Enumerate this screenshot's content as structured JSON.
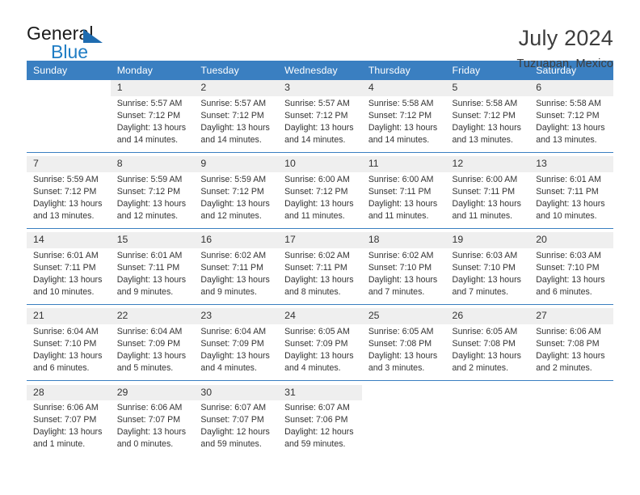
{
  "logo": {
    "word_top": "General",
    "word_bottom": "Blue",
    "triangle_icon": "triangle-icon",
    "color_black": "#1a1a1a",
    "color_blue": "#1f7dc4"
  },
  "header": {
    "title": "July 2024",
    "subtitle": "Tuzuapan, Mexico"
  },
  "theme": {
    "header_blue": "#3a7fc1",
    "daynum_band": "#efefef",
    "text": "#333333"
  },
  "calendar": {
    "weekday_headers": [
      "Sunday",
      "Monday",
      "Tuesday",
      "Wednesday",
      "Thursday",
      "Friday",
      "Saturday"
    ],
    "weeks": [
      [
        {
          "day": "",
          "lines": []
        },
        {
          "day": "1",
          "lines": [
            "Sunrise: 5:57 AM",
            "Sunset: 7:12 PM",
            "Daylight: 13 hours",
            "and 14 minutes."
          ]
        },
        {
          "day": "2",
          "lines": [
            "Sunrise: 5:57 AM",
            "Sunset: 7:12 PM",
            "Daylight: 13 hours",
            "and 14 minutes."
          ]
        },
        {
          "day": "3",
          "lines": [
            "Sunrise: 5:57 AM",
            "Sunset: 7:12 PM",
            "Daylight: 13 hours",
            "and 14 minutes."
          ]
        },
        {
          "day": "4",
          "lines": [
            "Sunrise: 5:58 AM",
            "Sunset: 7:12 PM",
            "Daylight: 13 hours",
            "and 14 minutes."
          ]
        },
        {
          "day": "5",
          "lines": [
            "Sunrise: 5:58 AM",
            "Sunset: 7:12 PM",
            "Daylight: 13 hours",
            "and 13 minutes."
          ]
        },
        {
          "day": "6",
          "lines": [
            "Sunrise: 5:58 AM",
            "Sunset: 7:12 PM",
            "Daylight: 13 hours",
            "and 13 minutes."
          ]
        }
      ],
      [
        {
          "day": "7",
          "lines": [
            "Sunrise: 5:59 AM",
            "Sunset: 7:12 PM",
            "Daylight: 13 hours",
            "and 13 minutes."
          ]
        },
        {
          "day": "8",
          "lines": [
            "Sunrise: 5:59 AM",
            "Sunset: 7:12 PM",
            "Daylight: 13 hours",
            "and 12 minutes."
          ]
        },
        {
          "day": "9",
          "lines": [
            "Sunrise: 5:59 AM",
            "Sunset: 7:12 PM",
            "Daylight: 13 hours",
            "and 12 minutes."
          ]
        },
        {
          "day": "10",
          "lines": [
            "Sunrise: 6:00 AM",
            "Sunset: 7:12 PM",
            "Daylight: 13 hours",
            "and 11 minutes."
          ]
        },
        {
          "day": "11",
          "lines": [
            "Sunrise: 6:00 AM",
            "Sunset: 7:11 PM",
            "Daylight: 13 hours",
            "and 11 minutes."
          ]
        },
        {
          "day": "12",
          "lines": [
            "Sunrise: 6:00 AM",
            "Sunset: 7:11 PM",
            "Daylight: 13 hours",
            "and 11 minutes."
          ]
        },
        {
          "day": "13",
          "lines": [
            "Sunrise: 6:01 AM",
            "Sunset: 7:11 PM",
            "Daylight: 13 hours",
            "and 10 minutes."
          ]
        }
      ],
      [
        {
          "day": "14",
          "lines": [
            "Sunrise: 6:01 AM",
            "Sunset: 7:11 PM",
            "Daylight: 13 hours",
            "and 10 minutes."
          ]
        },
        {
          "day": "15",
          "lines": [
            "Sunrise: 6:01 AM",
            "Sunset: 7:11 PM",
            "Daylight: 13 hours",
            "and 9 minutes."
          ]
        },
        {
          "day": "16",
          "lines": [
            "Sunrise: 6:02 AM",
            "Sunset: 7:11 PM",
            "Daylight: 13 hours",
            "and 9 minutes."
          ]
        },
        {
          "day": "17",
          "lines": [
            "Sunrise: 6:02 AM",
            "Sunset: 7:11 PM",
            "Daylight: 13 hours",
            "and 8 minutes."
          ]
        },
        {
          "day": "18",
          "lines": [
            "Sunrise: 6:02 AM",
            "Sunset: 7:10 PM",
            "Daylight: 13 hours",
            "and 7 minutes."
          ]
        },
        {
          "day": "19",
          "lines": [
            "Sunrise: 6:03 AM",
            "Sunset: 7:10 PM",
            "Daylight: 13 hours",
            "and 7 minutes."
          ]
        },
        {
          "day": "20",
          "lines": [
            "Sunrise: 6:03 AM",
            "Sunset: 7:10 PM",
            "Daylight: 13 hours",
            "and 6 minutes."
          ]
        }
      ],
      [
        {
          "day": "21",
          "lines": [
            "Sunrise: 6:04 AM",
            "Sunset: 7:10 PM",
            "Daylight: 13 hours",
            "and 6 minutes."
          ]
        },
        {
          "day": "22",
          "lines": [
            "Sunrise: 6:04 AM",
            "Sunset: 7:09 PM",
            "Daylight: 13 hours",
            "and 5 minutes."
          ]
        },
        {
          "day": "23",
          "lines": [
            "Sunrise: 6:04 AM",
            "Sunset: 7:09 PM",
            "Daylight: 13 hours",
            "and 4 minutes."
          ]
        },
        {
          "day": "24",
          "lines": [
            "Sunrise: 6:05 AM",
            "Sunset: 7:09 PM",
            "Daylight: 13 hours",
            "and 4 minutes."
          ]
        },
        {
          "day": "25",
          "lines": [
            "Sunrise: 6:05 AM",
            "Sunset: 7:08 PM",
            "Daylight: 13 hours",
            "and 3 minutes."
          ]
        },
        {
          "day": "26",
          "lines": [
            "Sunrise: 6:05 AM",
            "Sunset: 7:08 PM",
            "Daylight: 13 hours",
            "and 2 minutes."
          ]
        },
        {
          "day": "27",
          "lines": [
            "Sunrise: 6:06 AM",
            "Sunset: 7:08 PM",
            "Daylight: 13 hours",
            "and 2 minutes."
          ]
        }
      ],
      [
        {
          "day": "28",
          "lines": [
            "Sunrise: 6:06 AM",
            "Sunset: 7:07 PM",
            "Daylight: 13 hours",
            "and 1 minute."
          ]
        },
        {
          "day": "29",
          "lines": [
            "Sunrise: 6:06 AM",
            "Sunset: 7:07 PM",
            "Daylight: 13 hours",
            "and 0 minutes."
          ]
        },
        {
          "day": "30",
          "lines": [
            "Sunrise: 6:07 AM",
            "Sunset: 7:07 PM",
            "Daylight: 12 hours",
            "and 59 minutes."
          ]
        },
        {
          "day": "31",
          "lines": [
            "Sunrise: 6:07 AM",
            "Sunset: 7:06 PM",
            "Daylight: 12 hours",
            "and 59 minutes."
          ]
        },
        {
          "day": "",
          "lines": []
        },
        {
          "day": "",
          "lines": []
        },
        {
          "day": "",
          "lines": []
        }
      ]
    ]
  }
}
